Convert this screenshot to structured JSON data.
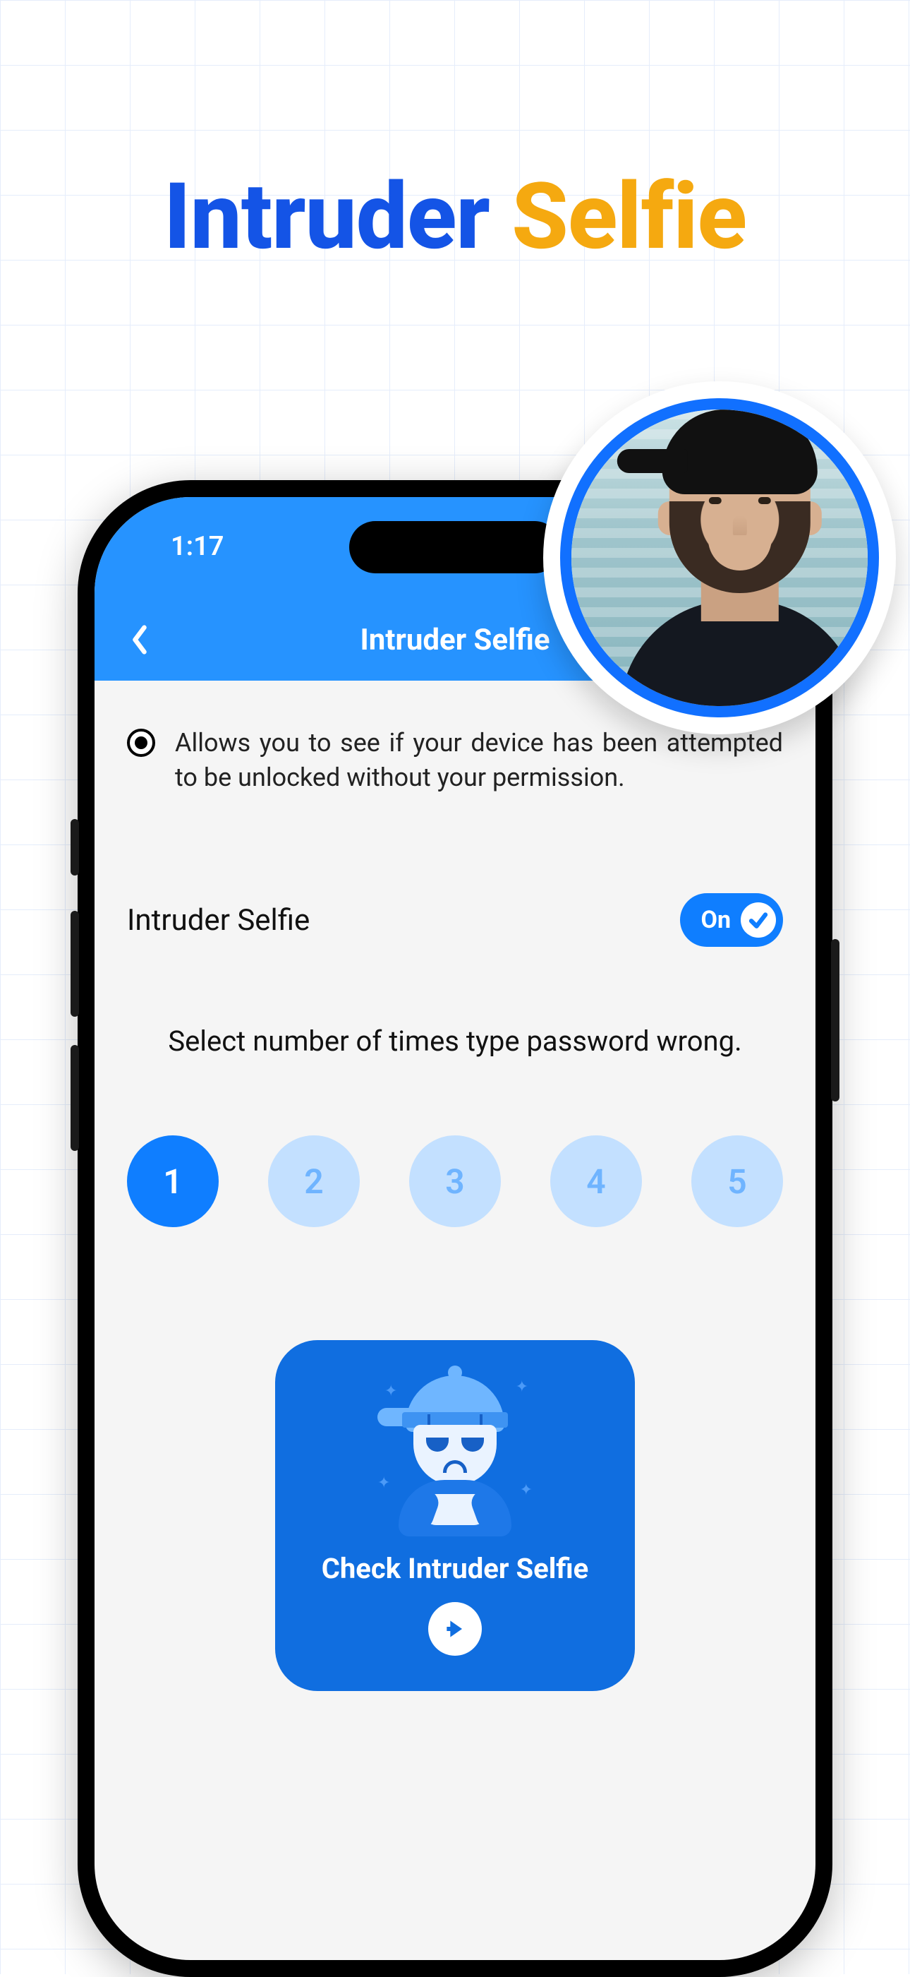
{
  "promo": {
    "word1": "Intruder",
    "word2": "Selfie"
  },
  "status": {
    "time": "1:17"
  },
  "nav": {
    "title": "Intruder Selfie"
  },
  "description": "Allows you to see if your device has been attempted to be unlocked without your permission.",
  "setting": {
    "label": "Intruder Selfie",
    "toggle_state": "On"
  },
  "instruction": "Select number of times type password wrong.",
  "options": {
    "values": [
      "1",
      "2",
      "3",
      "4",
      "5"
    ],
    "selected_index": 0
  },
  "card": {
    "title": "Check Intruder Selfie"
  },
  "colors": {
    "brand_blue": "#1454e6",
    "brand_orange": "#f5a910",
    "header_blue": "#2693ff",
    "accent_blue": "#0f7eff",
    "card_blue": "#106ee0",
    "option_bg": "#c3e0ff"
  }
}
